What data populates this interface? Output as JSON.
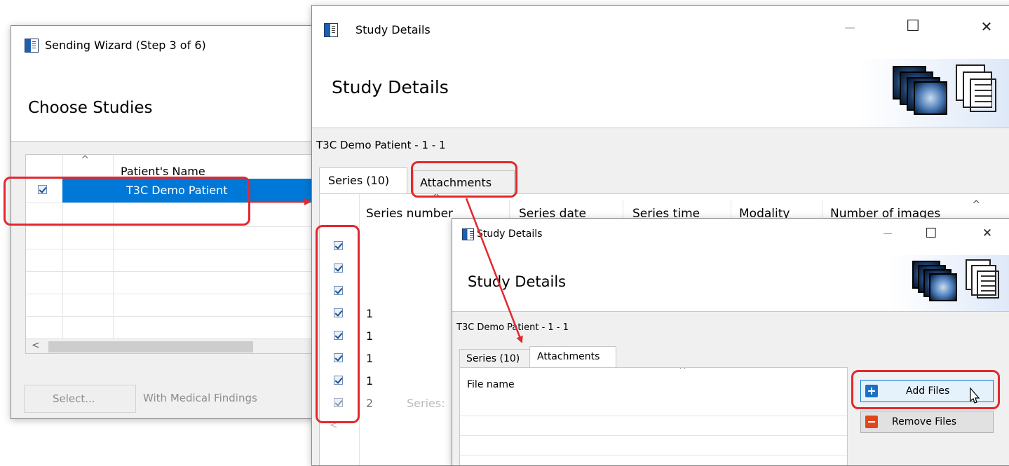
{
  "wizard": {
    "title": "Sending Wizard (Step 3 of 6)",
    "header_title": "Choose Studies",
    "column_patient_name": "Patient's Name",
    "sort_indicator": "^",
    "row_patient_name": "T3C Demo Patient",
    "scroll_left": "<",
    "select_button": "Select...",
    "with_findings": "With Medical Findings"
  },
  "details": {
    "title": "Study Details",
    "header_title": "Study Details",
    "patient_line": "T3C Demo Patient - 1 - 1",
    "tab_series": "Series (10)",
    "tab_attachments": "Attachments",
    "columns": [
      "Series number",
      "Series date",
      "Series time",
      "Modality",
      "Number of images"
    ],
    "series_numbers": [
      "",
      "",
      "",
      "1",
      "1",
      "1",
      "1",
      "2"
    ],
    "hidden_series_text": "Series:",
    "scroll_up": "^",
    "scroll_left": "<",
    "sort_indicator": "^",
    "window_controls": {
      "minimize": "—",
      "maximize": "☐",
      "close": "✕"
    }
  },
  "attachments": {
    "title": "Study Details",
    "header_title": "Study Details",
    "patient_line": "T3C Demo Patient - 1 - 1",
    "tab_series": "Series (10)",
    "tab_attachments": "Attachments",
    "column_file_name": "File name",
    "sort_indicator": "^",
    "add_files": "Add Files",
    "remove_files": "Remove Files",
    "window_controls": {
      "minimize": "—",
      "maximize": "☐",
      "close": "✕"
    }
  },
  "colors": {
    "selection": "#0078d7",
    "highlight": "#e3282e",
    "window_bg": "#f0f0f0"
  }
}
